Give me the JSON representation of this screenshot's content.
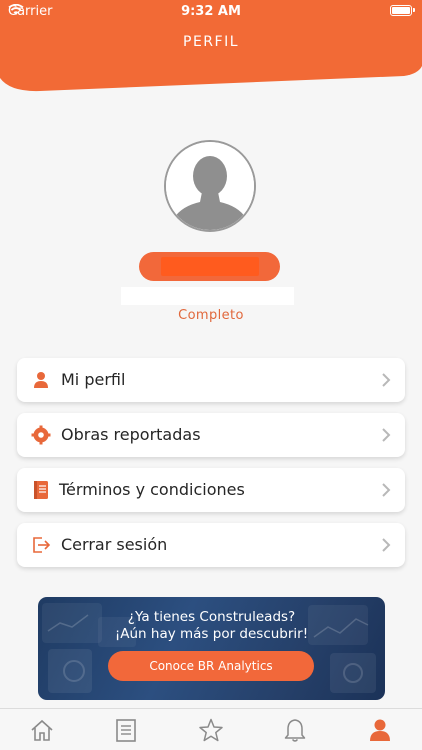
{
  "status_bar": {
    "carrier": "Carrier",
    "time": "9:32 AM"
  },
  "header": {
    "title": "PERFIL",
    "color": "#f26a36"
  },
  "profile": {
    "status": "Completo"
  },
  "menu": [
    {
      "label": "Mi perfil",
      "icon": "user-icon"
    },
    {
      "label": "Obras reportadas",
      "icon": "gear-icon"
    },
    {
      "label": "Términos y condiciones",
      "icon": "book-icon"
    },
    {
      "label": "Cerrar sesión",
      "icon": "logout-icon"
    }
  ],
  "banner": {
    "line1": "¿Ya tienes Construleads?",
    "line2": "¡Aún hay más por descubrir!",
    "button": "Conoce BR Analytics"
  },
  "tabbar": [
    {
      "icon": "home-icon",
      "active": false
    },
    {
      "icon": "document-icon",
      "active": false
    },
    {
      "icon": "star-icon",
      "active": false
    },
    {
      "icon": "bell-icon",
      "active": false
    },
    {
      "icon": "profile-icon",
      "active": true
    }
  ],
  "colors": {
    "accent": "#f26a36",
    "background": "#f6f6f6",
    "inactive_icon": "#8a8a8a"
  }
}
